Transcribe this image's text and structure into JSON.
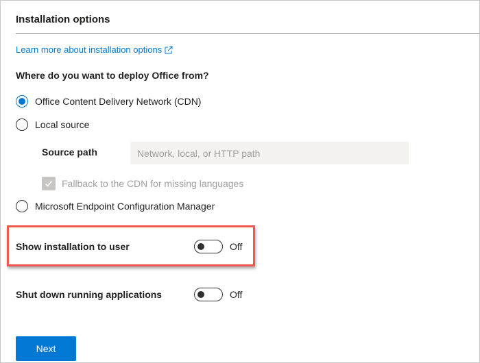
{
  "header": {
    "title": "Installation options"
  },
  "learn_link": {
    "label": "Learn more about installation options",
    "icon": "external-link-icon"
  },
  "deploy": {
    "question": "Where do you want to deploy Office from?",
    "options": [
      {
        "label": "Office Content Delivery Network (CDN)",
        "selected": true
      },
      {
        "label": "Local source",
        "selected": false
      },
      {
        "label": "Microsoft Endpoint Configuration Manager",
        "selected": false
      }
    ],
    "source_path": {
      "label": "Source path",
      "placeholder": "Network, local, or HTTP path",
      "value": ""
    },
    "fallback": {
      "label": "Fallback to the CDN for missing languages",
      "checked": true,
      "disabled": true
    }
  },
  "toggles": [
    {
      "label": "Show installation to user",
      "state": "Off"
    },
    {
      "label": "Shut down running applications",
      "state": "Off"
    }
  ],
  "footer": {
    "next_label": "Next"
  },
  "colors": {
    "accent": "#0078d4",
    "highlight": "#f0574e",
    "disabled": "#a19f9d"
  }
}
